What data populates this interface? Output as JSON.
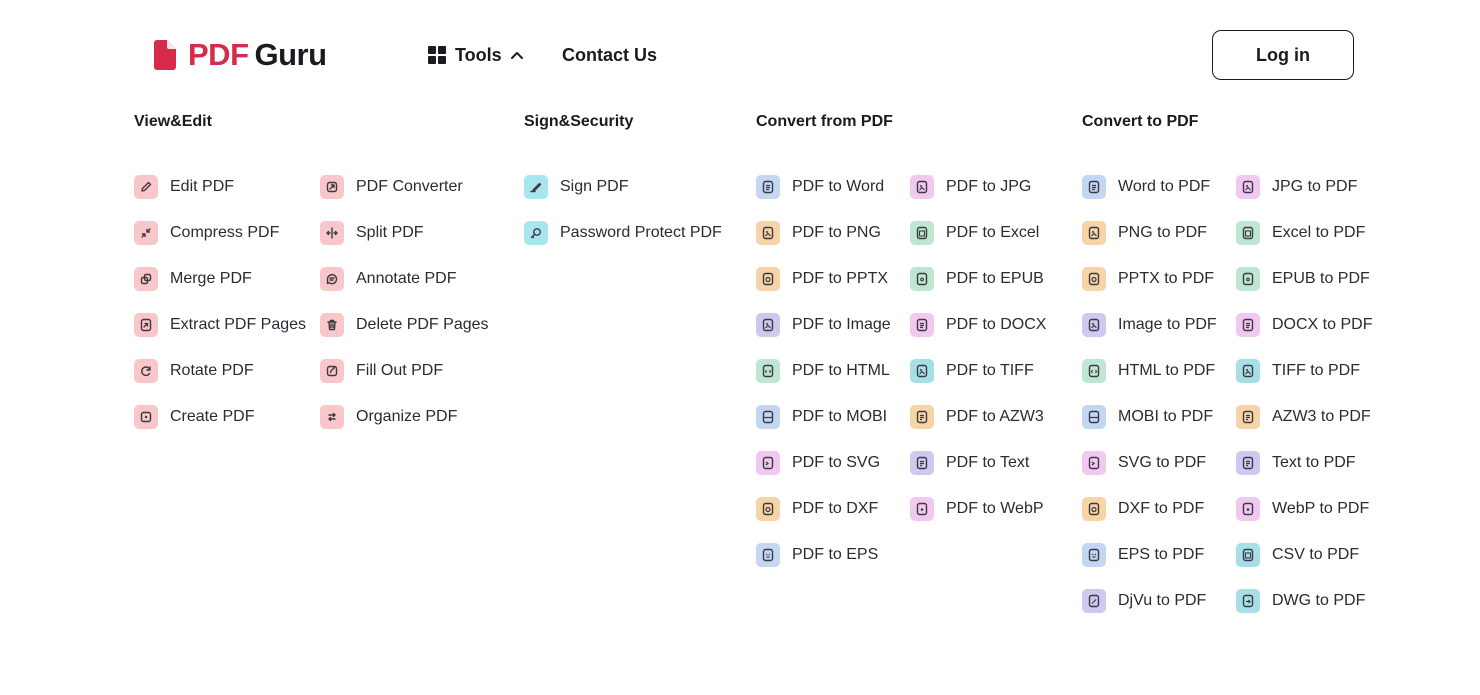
{
  "header": {
    "logo_pdf": "PDF",
    "logo_guru": "Guru",
    "tools_label": "Tools",
    "contact_label": "Contact Us",
    "login_label": "Log in",
    "brand_color": "#d62c4c"
  },
  "menu": {
    "view_edit": {
      "title": "View&Edit",
      "col1": [
        {
          "label": "Edit PDF",
          "icon": "pencil-icon",
          "color": "red"
        },
        {
          "label": "Compress PDF",
          "icon": "compress-icon",
          "color": "red"
        },
        {
          "label": "Merge PDF",
          "icon": "merge-icon",
          "color": "red"
        },
        {
          "label": "Extract PDF Pages",
          "icon": "extract-icon",
          "color": "red"
        },
        {
          "label": "Rotate PDF",
          "icon": "rotate-icon",
          "color": "red"
        },
        {
          "label": "Create PDF",
          "icon": "create-icon",
          "color": "red"
        }
      ],
      "col2": [
        {
          "label": "PDF Converter",
          "icon": "converter-icon",
          "color": "red"
        },
        {
          "label": "Split PDF",
          "icon": "split-icon",
          "color": "red"
        },
        {
          "label": "Annotate PDF",
          "icon": "annotate-icon",
          "color": "red"
        },
        {
          "label": "Delete PDF Pages",
          "icon": "trash-icon",
          "color": "red"
        },
        {
          "label": "Fill Out PDF",
          "icon": "fill-out-icon",
          "color": "red"
        },
        {
          "label": "Organize PDF",
          "icon": "organize-icon",
          "color": "red"
        }
      ]
    },
    "sign_security": {
      "title": "Sign&Security",
      "col1": [
        {
          "label": "Sign PDF",
          "icon": "signature-icon",
          "color": "cyan"
        },
        {
          "label": "Password Protect PDF",
          "icon": "lock-icon",
          "color": "cyan"
        }
      ]
    },
    "convert_from": {
      "title": "Convert from PDF",
      "col1": [
        {
          "label": "PDF to Word",
          "icon": "word-file-icon",
          "color": "blue"
        },
        {
          "label": "PDF to PNG",
          "icon": "png-file-icon",
          "color": "orange"
        },
        {
          "label": "PDF to PPTX",
          "icon": "pptx-file-icon",
          "color": "orange"
        },
        {
          "label": "PDF to Image",
          "icon": "image-file-icon",
          "color": "purple"
        },
        {
          "label": "PDF to HTML",
          "icon": "html-file-icon",
          "color": "green"
        },
        {
          "label": "PDF to MOBI",
          "icon": "mobi-file-icon",
          "color": "blue"
        },
        {
          "label": "PDF to SVG",
          "icon": "svg-file-icon",
          "color": "pink"
        },
        {
          "label": "PDF to DXF",
          "icon": "dxf-file-icon",
          "color": "orange"
        },
        {
          "label": "PDF to EPS",
          "icon": "eps-file-icon",
          "color": "blue"
        }
      ],
      "col2": [
        {
          "label": "PDF to JPG",
          "icon": "jpg-file-icon",
          "color": "pink"
        },
        {
          "label": "PDF to Excel",
          "icon": "excel-file-icon",
          "color": "green"
        },
        {
          "label": "PDF to EPUB",
          "icon": "epub-file-icon",
          "color": "green"
        },
        {
          "label": "PDF to DOCX",
          "icon": "docx-file-icon",
          "color": "pink"
        },
        {
          "label": "PDF to TIFF",
          "icon": "tiff-file-icon",
          "color": "teal"
        },
        {
          "label": "PDF to AZW3",
          "icon": "azw3-file-icon",
          "color": "orange"
        },
        {
          "label": "PDF to Text",
          "icon": "text-file-icon",
          "color": "purple"
        },
        {
          "label": "PDF to WebP",
          "icon": "webp-file-icon",
          "color": "pink"
        }
      ]
    },
    "convert_to": {
      "title": "Convert to PDF",
      "col1": [
        {
          "label": "Word to PDF",
          "icon": "word-file-icon",
          "color": "blue"
        },
        {
          "label": "PNG to PDF",
          "icon": "png-file-icon",
          "color": "orange"
        },
        {
          "label": "PPTX to PDF",
          "icon": "pptx-file-icon",
          "color": "orange"
        },
        {
          "label": "Image to PDF",
          "icon": "image-file-icon",
          "color": "purple"
        },
        {
          "label": "HTML to PDF",
          "icon": "html-file-icon",
          "color": "green"
        },
        {
          "label": "MOBI to PDF",
          "icon": "mobi-file-icon",
          "color": "blue"
        },
        {
          "label": "SVG to PDF",
          "icon": "svg-file-icon",
          "color": "pink"
        },
        {
          "label": "DXF to PDF",
          "icon": "dxf-file-icon",
          "color": "orange"
        },
        {
          "label": "EPS to PDF",
          "icon": "eps-file-icon",
          "color": "blue"
        },
        {
          "label": "DjVu to PDF",
          "icon": "djvu-file-icon",
          "color": "purple"
        }
      ],
      "col2": [
        {
          "label": "JPG to PDF",
          "icon": "jpg-file-icon",
          "color": "pink"
        },
        {
          "label": "Excel to PDF",
          "icon": "excel-file-icon",
          "color": "green"
        },
        {
          "label": "EPUB to PDF",
          "icon": "epub-file-icon",
          "color": "green"
        },
        {
          "label": "DOCX to PDF",
          "icon": "docx-file-icon",
          "color": "pink"
        },
        {
          "label": "TIFF to PDF",
          "icon": "tiff-file-icon",
          "color": "teal"
        },
        {
          "label": "AZW3 to PDF",
          "icon": "azw3-file-icon",
          "color": "orange"
        },
        {
          "label": "Text to PDF",
          "icon": "text-file-icon",
          "color": "purple"
        },
        {
          "label": "WebP to PDF",
          "icon": "webp-file-icon",
          "color": "pink"
        },
        {
          "label": "CSV to PDF",
          "icon": "csv-file-icon",
          "color": "teal"
        },
        {
          "label": "DWG to PDF",
          "icon": "dwg-file-icon",
          "color": "teal"
        }
      ]
    }
  }
}
